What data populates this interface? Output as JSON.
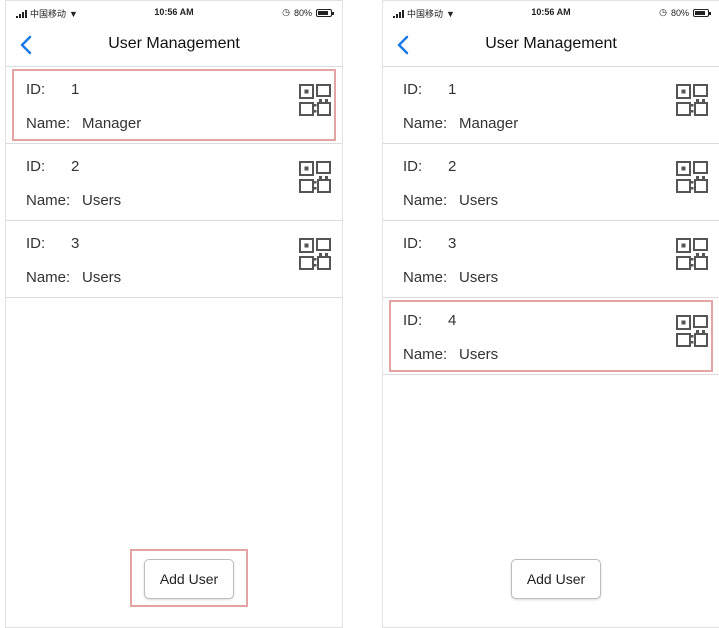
{
  "colors": {
    "accent": "#1a7ae6",
    "highlight": "#e4a4a4",
    "divider": "#dcdcdc"
  },
  "icons": {
    "back": "chevron-left-icon",
    "qr": "qr-code-icon",
    "signal": "signal-icon",
    "wifi": "wifi-icon",
    "battery": "battery-icon"
  },
  "screens": [
    {
      "status": {
        "carrier": "中国移动",
        "time": "10:56 AM",
        "battery": "80%"
      },
      "nav": {
        "title": "User Management"
      },
      "labels": {
        "id": "ID:",
        "name": "Name:"
      },
      "users": [
        {
          "id": "1",
          "name": "Manager",
          "highlighted": true
        },
        {
          "id": "2",
          "name": "Users"
        },
        {
          "id": "3",
          "name": "Users"
        }
      ],
      "add_button": {
        "label": "Add User",
        "highlighted": true
      }
    },
    {
      "status": {
        "carrier": "中国移动",
        "time": "10:56 AM",
        "battery": "80%"
      },
      "nav": {
        "title": "User Management"
      },
      "labels": {
        "id": "ID:",
        "name": "Name:"
      },
      "users": [
        {
          "id": "1",
          "name": "Manager"
        },
        {
          "id": "2",
          "name": "Users"
        },
        {
          "id": "3",
          "name": "Users"
        },
        {
          "id": "4",
          "name": "Users",
          "highlighted": true
        }
      ],
      "add_button": {
        "label": "Add User"
      }
    }
  ]
}
